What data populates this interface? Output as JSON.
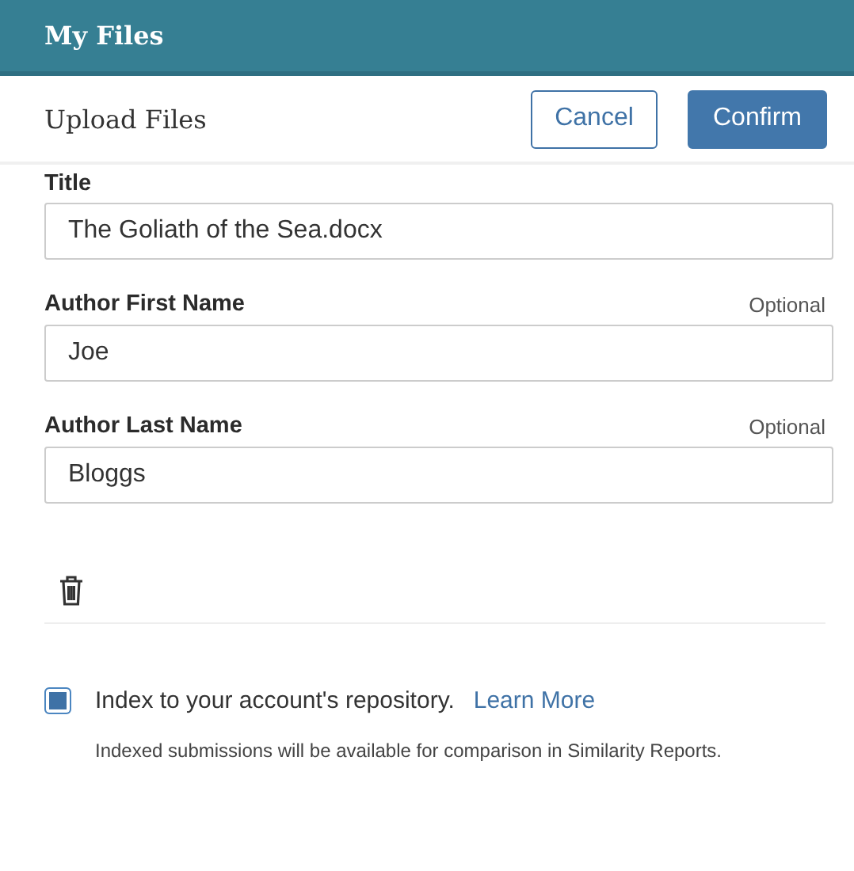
{
  "header": {
    "title": "My Files"
  },
  "toolbar": {
    "title": "Upload Files",
    "buttons": [
      {
        "label": "Cancel",
        "kind": "secondary"
      },
      {
        "label": "Confirm",
        "kind": "primary"
      }
    ]
  },
  "fields": [
    {
      "label": "Title",
      "value": "The Goliath of the Sea.docx"
    },
    {
      "label": "Author First Name",
      "hint": "Optional",
      "value": "Joe"
    },
    {
      "label": "Author Last Name",
      "hint": "Optional",
      "value": "Bloggs"
    }
  ],
  "index_option": {
    "label": "Index to your account's repository.",
    "link": "Learn More",
    "checked": true,
    "note": "Indexed submissions will be available for comparison in Similarity Reports."
  }
}
